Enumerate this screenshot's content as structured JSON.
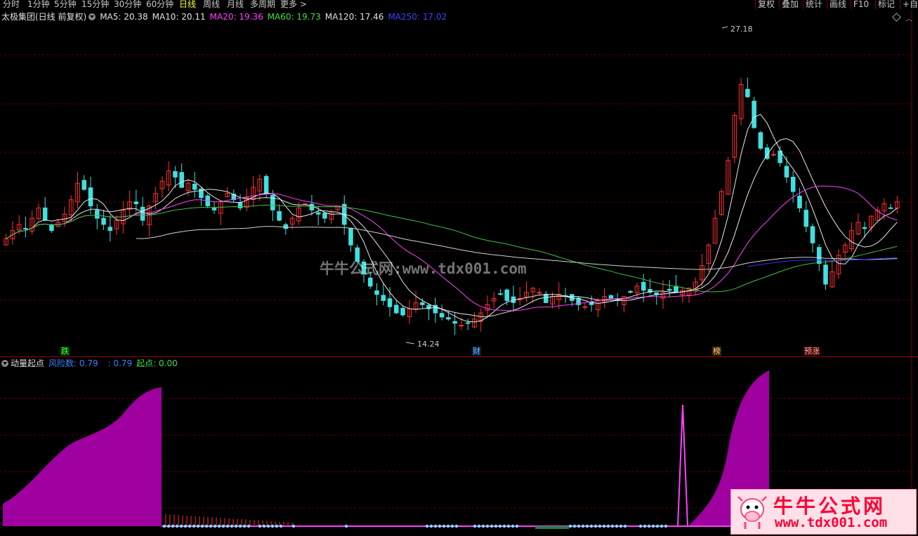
{
  "toolbar": {
    "periods": [
      "分时",
      "1分钟",
      "5分钟",
      "15分钟",
      "30分钟",
      "60分钟",
      "日线",
      "周线",
      "月线",
      "多周期",
      "更多 >"
    ],
    "active_period": "日线",
    "right_buttons": [
      "复权",
      "叠加",
      "统计",
      "画线",
      "F10",
      "标记",
      "+自"
    ]
  },
  "main_chart": {
    "title": "太极集团(日线 前复权)",
    "ma": [
      {
        "label": "MA5: 20.38",
        "color": "#e0e0e0"
      },
      {
        "label": "MA10: 20.11",
        "color": "#e0e0e0"
      },
      {
        "label": "MA20: 19.36",
        "color": "#ff40ff"
      },
      {
        "label": "MA60: 19.73",
        "color": "#40e040"
      },
      {
        "label": "MA120: 17.46",
        "color": "#e0e0e0"
      },
      {
        "label": "MA250: 17.02",
        "color": "#4040ff"
      }
    ],
    "high_label": "27.18",
    "low_label": "14.24",
    "events": [
      {
        "text": "跌",
        "color": "#40ff40",
        "bg": "#004000"
      },
      {
        "text": "财",
        "color": "#80c0ff",
        "bg": "#002040"
      },
      {
        "text": "榜",
        "color": "#ffd080",
        "bg": "#402000"
      },
      {
        "text": "预涨",
        "color": "#ffb0b0",
        "bg": "#400000"
      }
    ],
    "colors": {
      "up": "#ff3030",
      "down": "#40e0e0",
      "grid": "#5a0000",
      "ma5": "#e8e8e8",
      "ma20": "#ff40ff",
      "ma60": "#40c040",
      "ma120": "#d0d0d0",
      "ma250": "#3030ff"
    }
  },
  "indicator": {
    "name": "动量起点",
    "items": [
      {
        "label": "风险数: 0.79",
        "color": "#4080ff"
      },
      {
        "label": ": 0.79",
        "color": "#4080ff"
      },
      {
        "label": "起点: 0.00",
        "color": "#40e040"
      }
    ],
    "fill_color": "#a000a0",
    "spike_color": "#ff40ff"
  },
  "watermark": {
    "center": "牛牛公式网:www.tdx001.com",
    "logo_title": "牛牛公式网",
    "logo_url": "www.tdx001.com"
  },
  "chart_data": {
    "type": "candlestick",
    "title": "太极集团(日线 前复权)",
    "ylim": [
      13.5,
      28.5
    ],
    "highest": 27.18,
    "lowest": 14.24,
    "closes": [
      18.6,
      19.0,
      19.3,
      19.1,
      19.6,
      20.1,
      19.5,
      19.0,
      19.4,
      19.8,
      20.5,
      21.3,
      21.0,
      20.2,
      19.6,
      19.3,
      19.0,
      19.5,
      20.0,
      20.4,
      20.3,
      19.5,
      20.2,
      20.8,
      21.4,
      21.9,
      21.6,
      21.1,
      21.3,
      21.0,
      20.6,
      20.2,
      20.0,
      20.4,
      20.8,
      20.5,
      20.1,
      20.6,
      21.1,
      21.5,
      20.8,
      20.0,
      19.5,
      19.1,
      19.6,
      20.1,
      20.3,
      20.0,
      19.8,
      19.6,
      19.9,
      20.2,
      19.3,
      18.3,
      17.5,
      16.9,
      16.3,
      15.9,
      15.6,
      15.3,
      15.0,
      14.9,
      15.2,
      15.5,
      15.4,
      15.2,
      15.0,
      14.8,
      14.7,
      14.5,
      14.4,
      14.5,
      14.7,
      15.0,
      15.4,
      15.7,
      15.9,
      15.6,
      15.5,
      15.7,
      16.0,
      16.2,
      16.0,
      15.5,
      15.8,
      15.9,
      15.8,
      15.6,
      15.4,
      15.3,
      15.4,
      15.6,
      15.8,
      15.7,
      15.6,
      15.8,
      16.0,
      16.3,
      16.1,
      16.0,
      15.9,
      16.0,
      16.1,
      16.0,
      16.1,
      16.2,
      16.5,
      17.3,
      18.3,
      19.6,
      20.9,
      22.4,
      24.6,
      26.1,
      25.5,
      24.0,
      23.0,
      22.5,
      22.7,
      22.3,
      21.6,
      20.9,
      20.1,
      19.2,
      18.4,
      17.4,
      16.4,
      17.0,
      17.8,
      18.3,
      19.0,
      19.4,
      19.1,
      19.7,
      20.0,
      20.3,
      20.1,
      20.4
    ],
    "indicator_values": {
      "risk": 0.79,
      "start": 0.0
    }
  }
}
